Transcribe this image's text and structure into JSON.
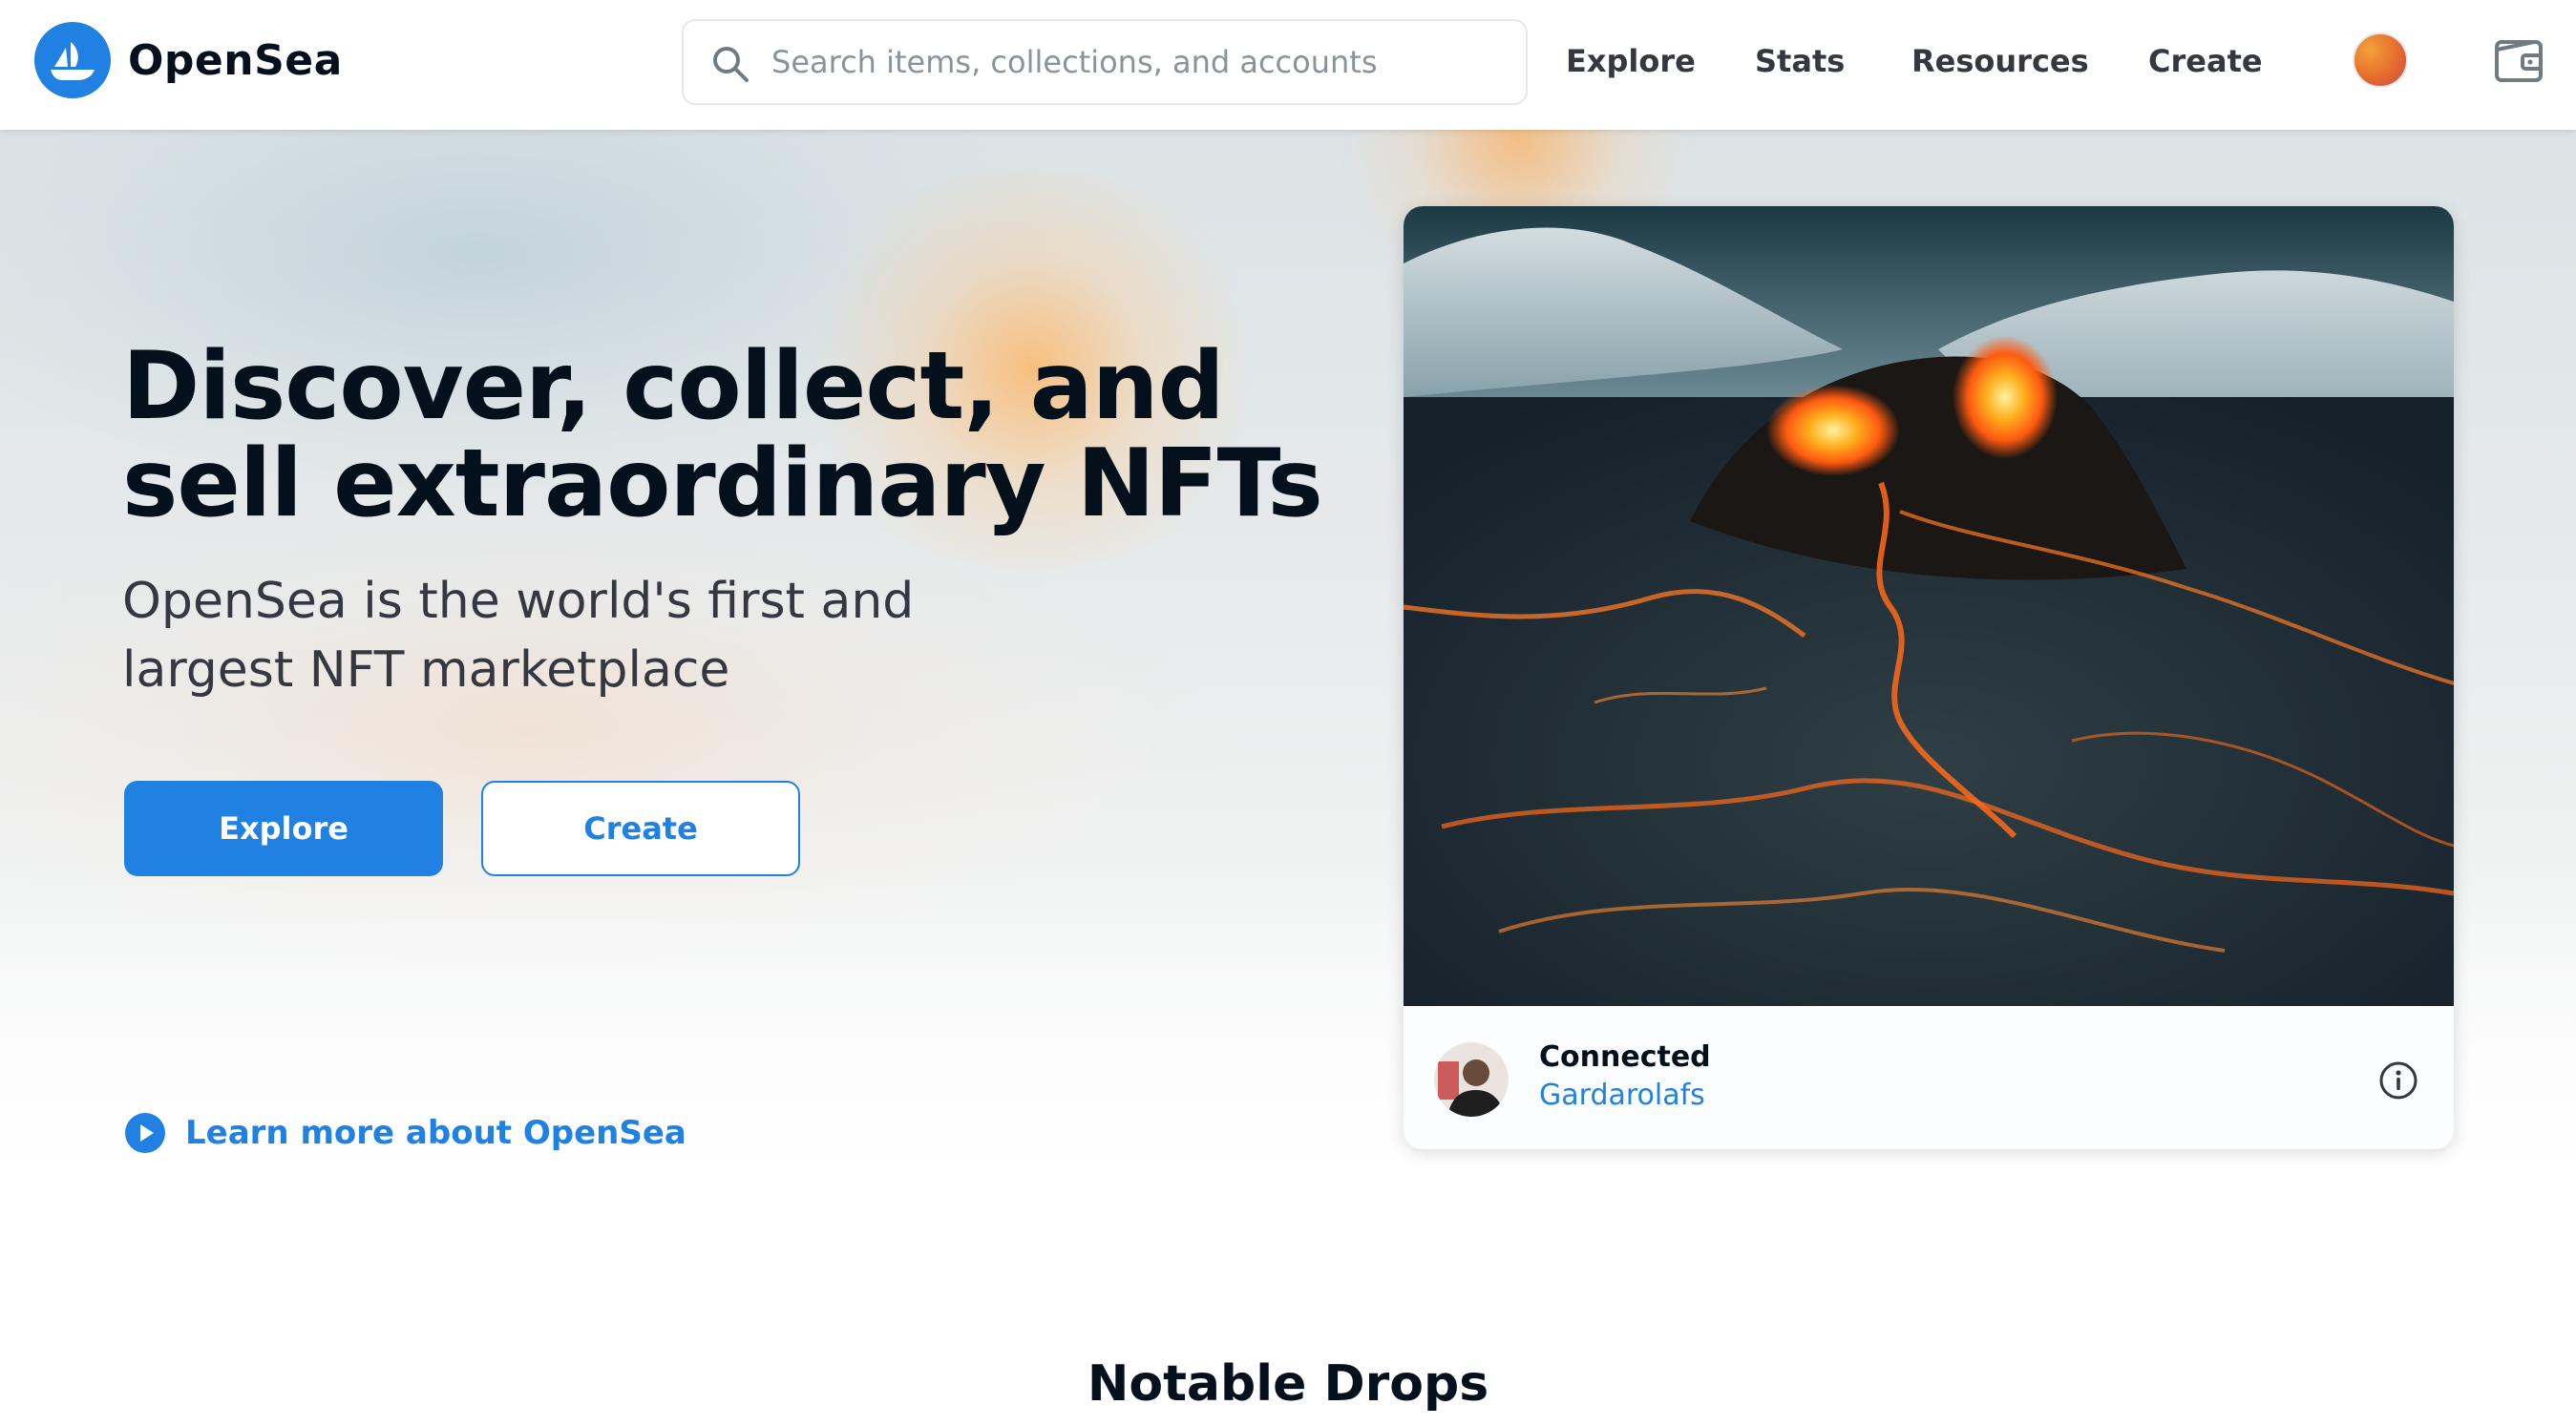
{
  "header": {
    "brand": "OpenSea",
    "search": {
      "placeholder": "Search items, collections, and accounts",
      "value": ""
    },
    "nav": [
      "Explore",
      "Stats",
      "Resources",
      "Create"
    ],
    "icons": {
      "logo": "opensea-boat-logo",
      "search": "search-icon",
      "avatar": "user-avatar",
      "wallet": "wallet-icon"
    }
  },
  "hero": {
    "title": "Discover, collect, and sell extraordinary NFTs",
    "subtitle": "OpenSea is the world's first and largest NFT marketplace",
    "explore_label": "Explore",
    "create_label": "Create",
    "learn_more": "Learn more about OpenSea"
  },
  "featured": {
    "title": "Connected",
    "creator": "Gardarolafs",
    "image": "volcano eruption with lava flows"
  },
  "sections": {
    "notable_drops": "Notable Drops"
  },
  "colors": {
    "accent": "#2081e2",
    "text_primary": "#04111d",
    "text_secondary": "#353840",
    "border": "#e5e8eb"
  }
}
